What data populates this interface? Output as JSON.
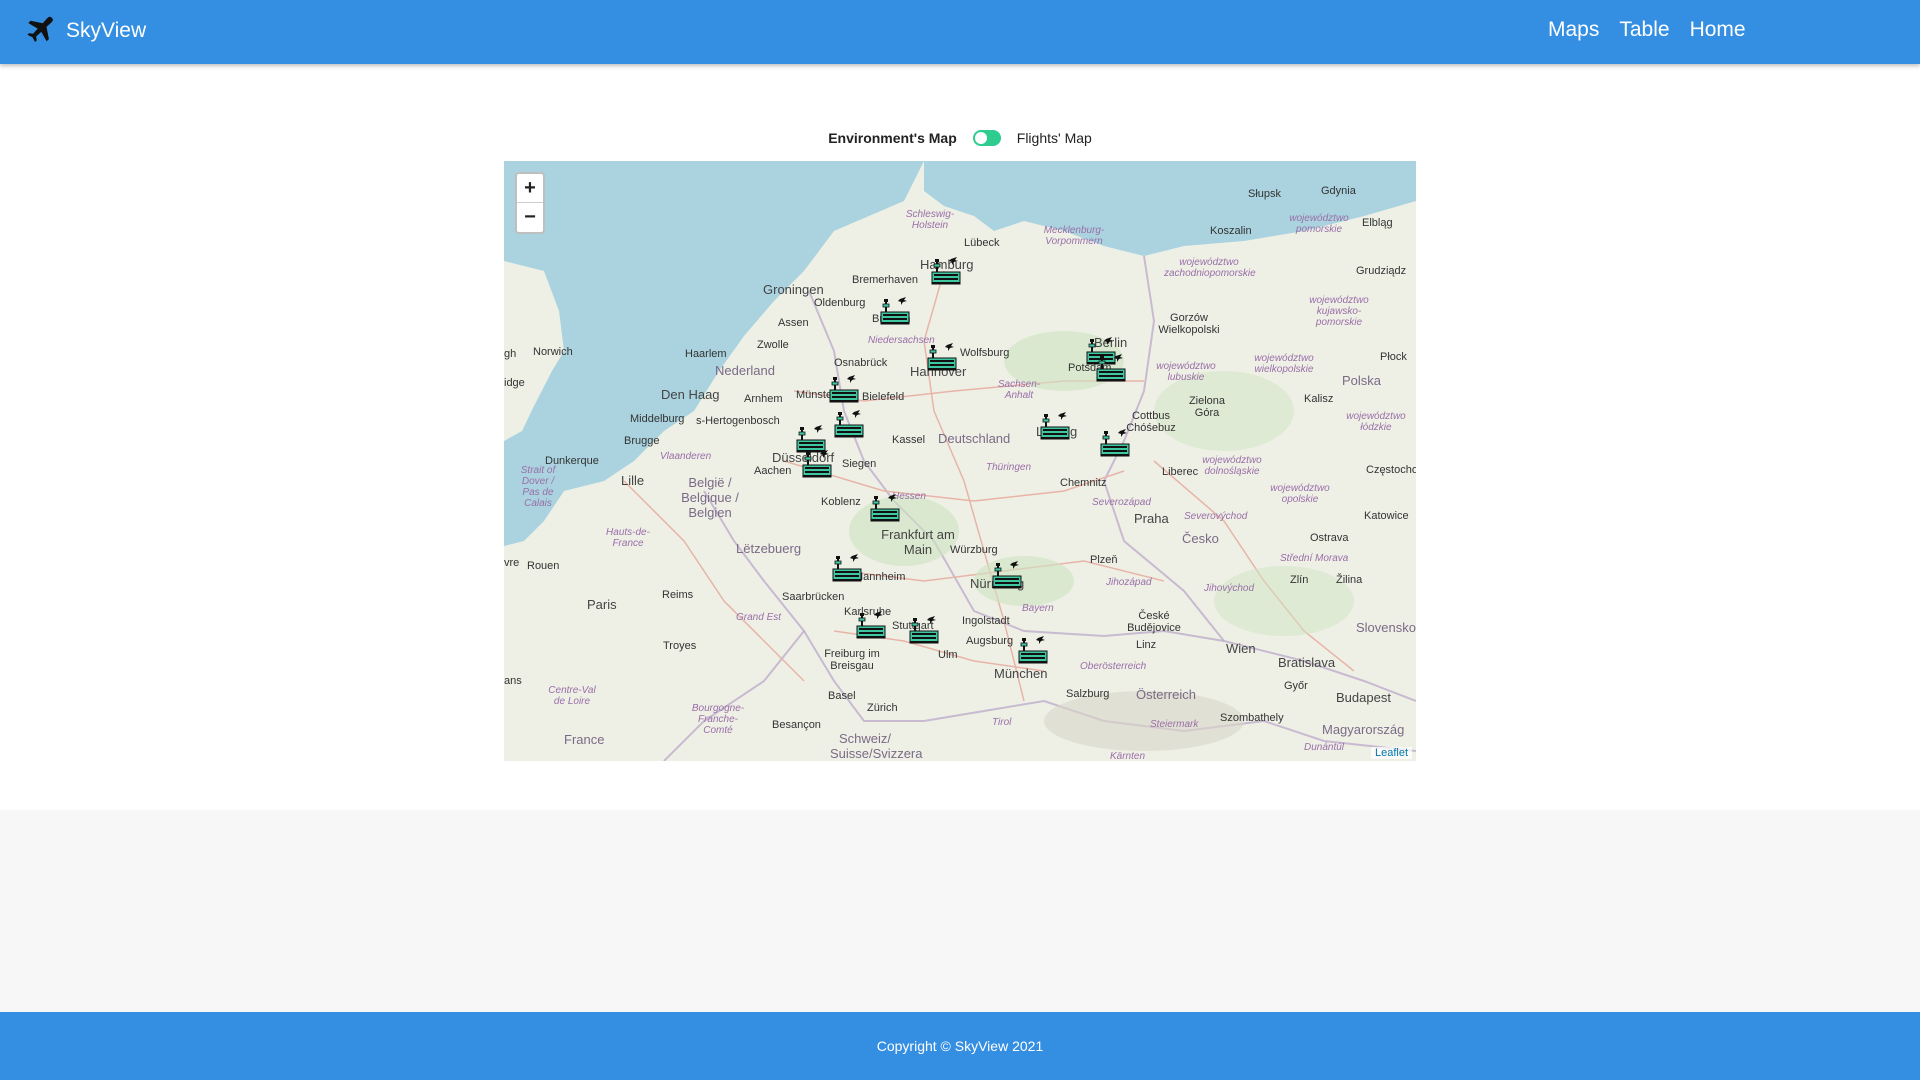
{
  "navbar": {
    "brand": "SkyView",
    "links": [
      "Maps",
      "Table",
      "Home"
    ]
  },
  "toggle": {
    "left_label": "Environment's Map",
    "right_label": "Flights' Map"
  },
  "map": {
    "zoom_in": "+",
    "zoom_out": "−",
    "attribution": "Leaflet",
    "labels": {
      "slupsk": "Słupsk",
      "gdynia": "Gdynia",
      "elblag": "Elbląg",
      "koszalin": "Koszalin",
      "lubeck": "Lübeck",
      "hamburg": "Hamburg",
      "bremerhaven": "Bremerhaven",
      "groningen": "Groningen",
      "oldenburg": "Oldenburg",
      "bremen": "Bremen",
      "assen": "Assen",
      "zwolle": "Zwolle",
      "haarlem": "Haarlem",
      "nederland": "Nederland",
      "osnabruck": "Osnabrück",
      "hannover": "Hannover",
      "wolfsburg": "Wolfsburg",
      "norwich": "Norwich",
      "den_haag": "Den Haag",
      "arnhem": "Arnhem",
      "munster": "Münster",
      "bielefeld": "Bielefeld",
      "berlin": "Berlin",
      "potsdam": "Potsdam",
      "gorzow": "Gorzów Wielkopolski",
      "grudziadz": "Grudziądz",
      "plock": "Płock",
      "polska": "Polska",
      "kalisz": "Kalisz",
      "zielona_gora": "Zielona Góra",
      "cottbus": "Cottbus Chóśebuz",
      "middelburg": "Middelburg",
      "s_hertogenbosch": "s-Hertogenbosch",
      "brugge": "Brugge",
      "dunkerque": "Dunkerque",
      "lille": "Lille",
      "duesseldorf": "Düsseldorf",
      "aachen": "Aachen",
      "kassel": "Kassel",
      "deutschland": "Deutschland",
      "leipzig": "Leipzig",
      "siegen": "Siegen",
      "belgie": "België / Belgique / Belgien",
      "koblenz": "Koblenz",
      "chemnitz": "Chemnitz",
      "liberec": "Liberec",
      "czestochowa": "Częstochowa",
      "katowice": "Katowice",
      "praha": "Praha",
      "cesko": "Česko",
      "ostrava": "Ostrava",
      "frankfurt": "Frankfurt am Main",
      "letzebuerg": "Lëtzebuerg",
      "wurzburg": "Würzburg",
      "mannheim": "Mannheim",
      "plzen": "Plzeň",
      "zlin": "Zlín",
      "zilina": "Žilina",
      "rouen": "Rouen",
      "nurnberg": "Nürnberg",
      "reims": "Reims",
      "saarbrucken": "Saarbrücken",
      "paris": "Paris",
      "karlsruhe": "Karlsruhe",
      "stuttgart": "Stuttgart",
      "ingolstadt": "Ingolstadt",
      "ceske_budejovice": "České Budějovice",
      "linz": "Linz",
      "wien": "Wien",
      "bratislava": "Bratislava",
      "augsburg": "Augsburg",
      "troyes": "Troyes",
      "freiburg": "Freiburg im Breisgau",
      "ulm": "Ulm",
      "munchen": "München",
      "gyor": "Győr",
      "salzburg": "Salzburg",
      "osterreich": "Österreich",
      "budapest": "Budapest",
      "basel": "Basel",
      "zurich": "Zürich",
      "szombathely": "Szombathely",
      "besancon": "Besançon",
      "france": "France",
      "schweiz": "Schweiz/ Suisse/Svizzera",
      "magyarorszag": "Magyarország",
      "slovensko": "Slovensko",
      "schleswig": "Schleswig-Holstein",
      "mecklenburg": "Mecklenburg-Vorpommern",
      "niedersachsen": "Niedersachsen",
      "sachsen_anhalt": "Sachsen-Anhalt",
      "thuringen": "Thüringen",
      "hessen": "Hessen",
      "bayern": "Bayern",
      "vlaanderen": "Vlaanderen",
      "grand_est": "Grand Est",
      "wojewodztwo_pomorskie": "województwo pomorskie",
      "wojewodztwo_zach": "województwo zachodniopomorskie",
      "wojewodztwo_lubuskie": "województwo lubuskie",
      "wojewodztwo_wielk": "województwo wielkopolskie",
      "wojewodztwo_kujawsko": "województwo kujawsko-pomorskie",
      "wojewodztwo_dolno": "województwo dolnośląskie",
      "wojewodztwo_opolskie": "województwo opolskie",
      "wojewodztwo_lodzkie": "województwo łódzkie",
      "severozapad": "Severozápad",
      "severovychod": "Severovýchod",
      "jihozapad": "Jihozápad",
      "jihovychod": "Jihovýchod",
      "stredni_morava": "Střední Morava",
      "oberosterreich": "Oberösterreich",
      "steiermark": "Steiermark",
      "karnten": "Kärnten",
      "tirol": "Tirol",
      "dunantul": "Dunántúl",
      "hauts_de_france": "Hauts-de-France",
      "centre_val": "Centre-Val de Loire",
      "bourgogne": "Bourgogne-Franche-Comté",
      "strait": "Strait of Dover / Pas de Calais",
      "ans": "ans",
      "vre": "vre",
      "gh": "gh",
      "idge": "idge"
    },
    "marker_icon": "airport-icon"
  },
  "footer": {
    "copyright": "Copyright © SkyView 2021"
  },
  "colors": {
    "primary": "#348fe2",
    "toggle_on": "#2ecc8f",
    "marker": "#3fc7a2",
    "sea": "#aad3df",
    "land": "#eef0e6"
  }
}
